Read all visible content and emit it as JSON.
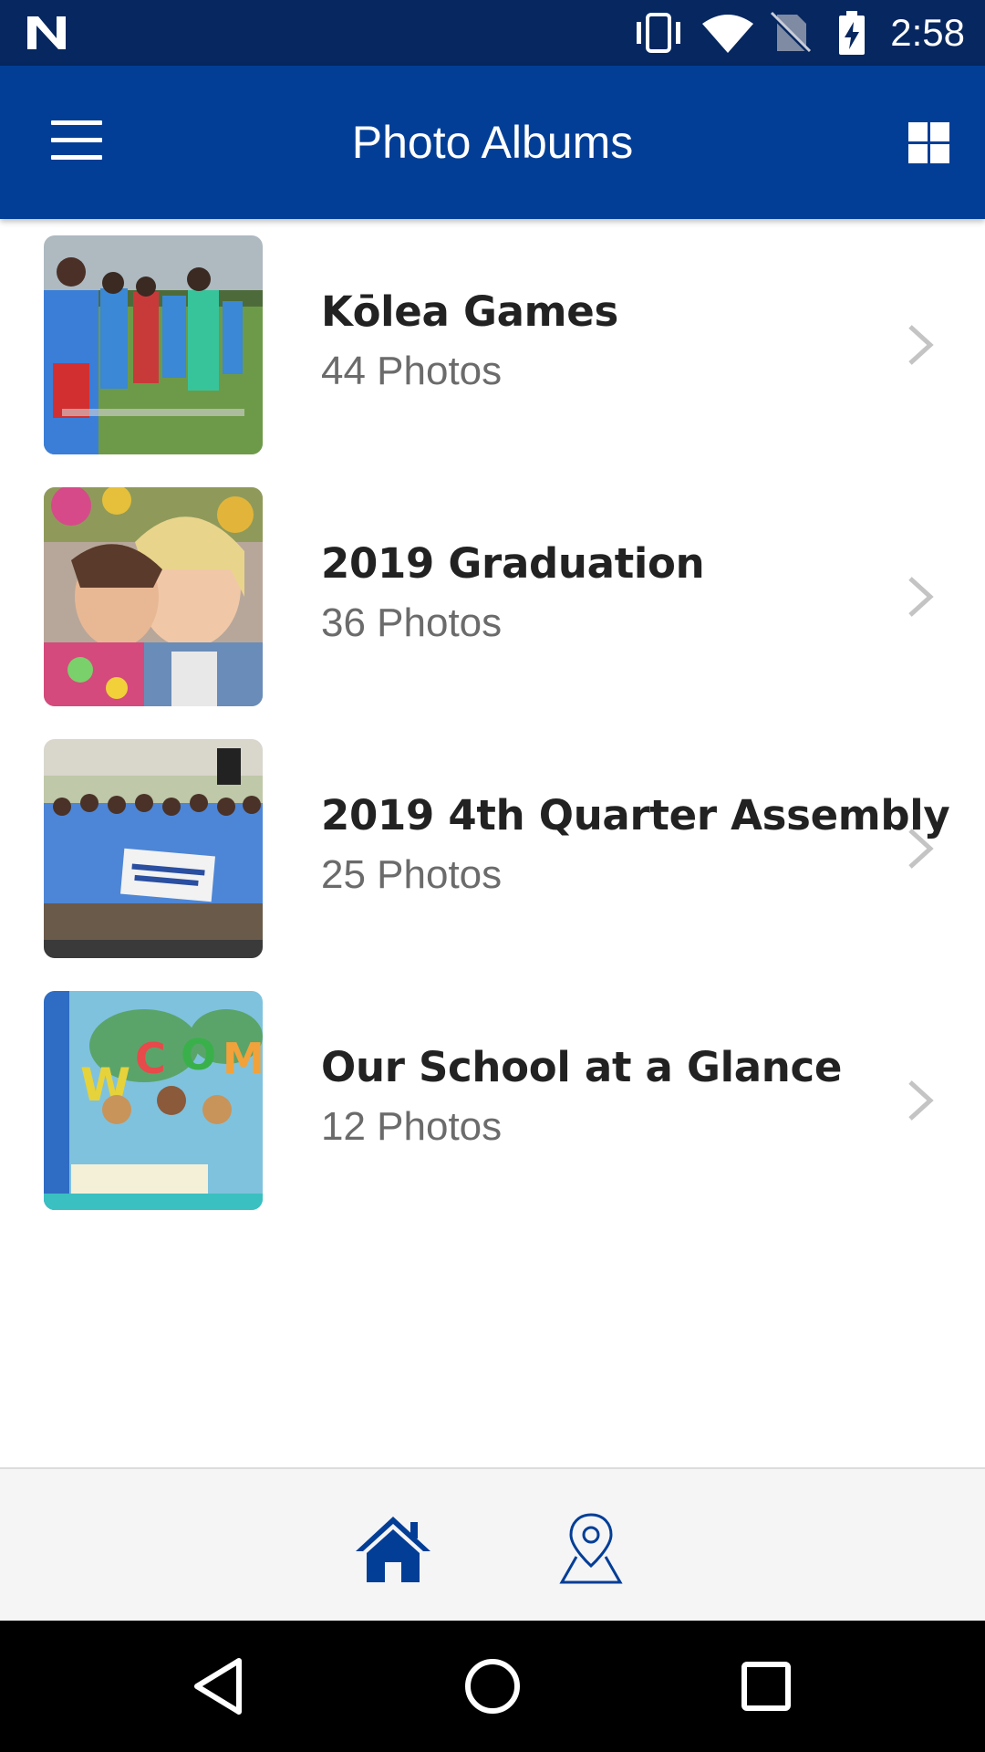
{
  "status_bar": {
    "time": "2:58",
    "icons": [
      "n-logo-icon",
      "vibrate-icon",
      "wifi-icon",
      "no-sim-icon",
      "battery-charging-icon"
    ]
  },
  "app_bar": {
    "title": "Photo Albums",
    "left_icon": "menu-icon",
    "right_icon": "grid-view-icon"
  },
  "albums": [
    {
      "title": "Kōlea Games",
      "count": "44 Photos"
    },
    {
      "title": "2019 Graduation",
      "count": "36 Photos"
    },
    {
      "title": "2019 4th Quarter Assembly",
      "count": "25 Photos"
    },
    {
      "title": "Our School at a Glance",
      "count": "12 Photos"
    }
  ],
  "bottom_nav": {
    "items": [
      {
        "icon": "home-icon",
        "active": true
      },
      {
        "icon": "map-pin-icon",
        "active": false
      }
    ]
  },
  "system_nav": {
    "buttons": [
      "back-icon",
      "home-circle-icon",
      "recents-icon"
    ]
  },
  "colors": {
    "status_bar": "#06275f",
    "app_bar": "#033e96",
    "accent": "#033e96",
    "title_text": "#222222",
    "subtitle_text": "#6b6b6b",
    "chevron": "#c4c4c4",
    "bottom_nav_bg": "#f5f5f6"
  }
}
